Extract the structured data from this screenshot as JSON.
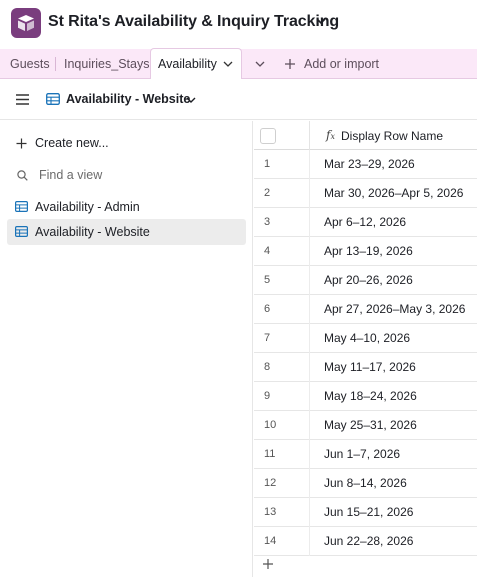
{
  "header": {
    "base_title": "St Rita's Availability & Inquiry Tracking"
  },
  "tabs": [
    {
      "label": "Guests"
    },
    {
      "label": "Inquiries_Stays"
    },
    {
      "label": "Availability"
    }
  ],
  "add_or_import_label": "Add or import",
  "view": {
    "name": "Availability - Website"
  },
  "sidebar": {
    "create_new_label": "Create new...",
    "find_view_placeholder": "Find a view",
    "views": [
      {
        "label": "Availability - Admin"
      },
      {
        "label": "Availability - Website"
      }
    ]
  },
  "grid": {
    "column_name": "Display Row Name",
    "rows": [
      {
        "num": "1",
        "value": "Mar 23–29, 2026"
      },
      {
        "num": "2",
        "value": "Mar 30, 2026–Apr 5, 2026"
      },
      {
        "num": "3",
        "value": "Apr 6–12, 2026"
      },
      {
        "num": "4",
        "value": "Apr 13–19, 2026"
      },
      {
        "num": "5",
        "value": "Apr 20–26, 2026"
      },
      {
        "num": "6",
        "value": "Apr 27, 2026–May 3, 2026"
      },
      {
        "num": "7",
        "value": "May 4–10, 2026"
      },
      {
        "num": "8",
        "value": "May 11–17, 2026"
      },
      {
        "num": "9",
        "value": "May 18–24, 2026"
      },
      {
        "num": "10",
        "value": "May 25–31, 2026"
      },
      {
        "num": "11",
        "value": "Jun 1–7, 2026"
      },
      {
        "num": "12",
        "value": "Jun 8–14, 2026"
      },
      {
        "num": "13",
        "value": "Jun 15–21, 2026"
      },
      {
        "num": "14",
        "value": "Jun 22–28, 2026"
      }
    ]
  },
  "colors": {
    "brand": "#7a3d7e",
    "tabbar_bg": "#fbe8f8",
    "view_icon": "#1a73b8"
  }
}
